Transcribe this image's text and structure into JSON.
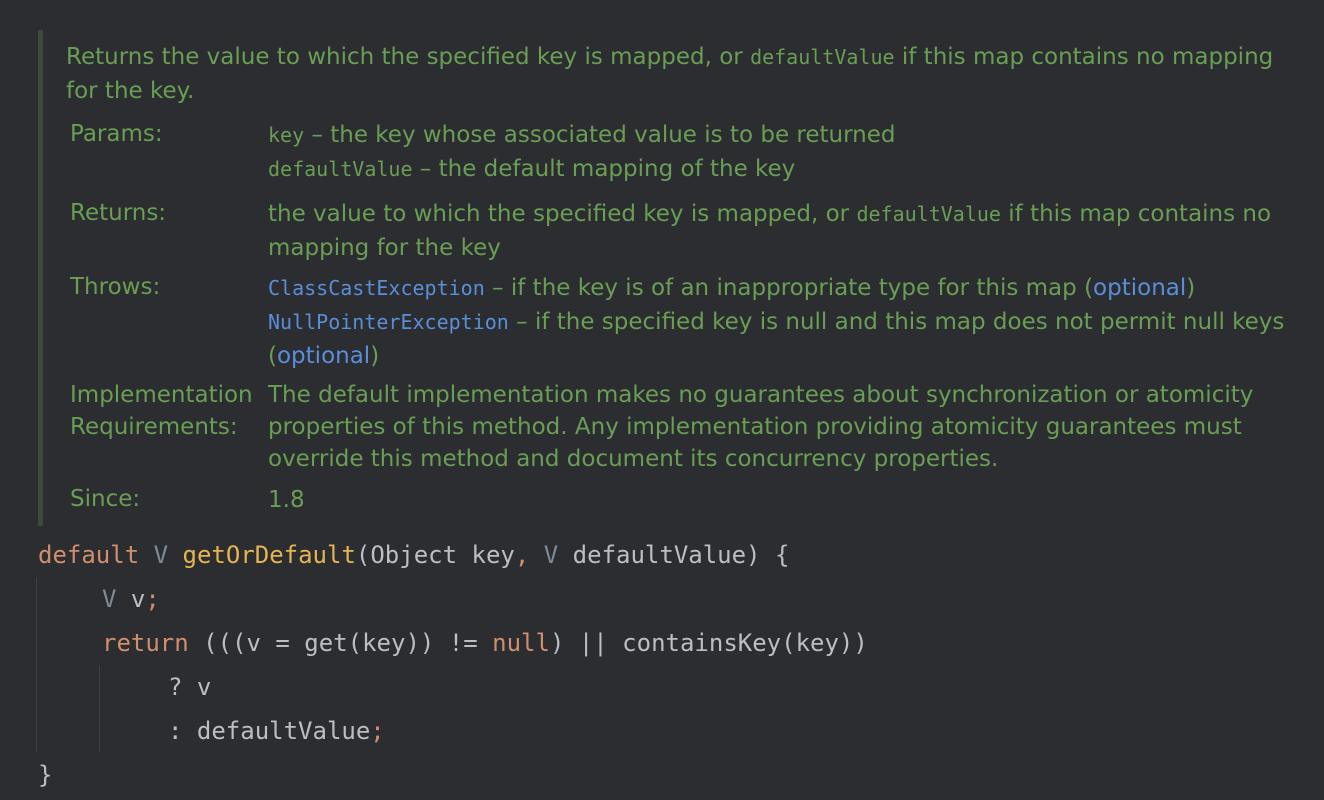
{
  "doc": {
    "summary_pre": "Returns the value to which the specified key is mapped, or ",
    "summary_code": "defaultValue",
    "summary_post": " if this map contains no mapping for the key.",
    "params_label": "Params:",
    "params": [
      {
        "name": "key",
        "text": " – the key whose associated value is to be returned"
      },
      {
        "name": "defaultValue",
        "text": " – the default mapping of the key"
      }
    ],
    "returns_label": "Returns:",
    "returns_pre": "the value to which the specified key is mapped, or ",
    "returns_code": "defaultValue",
    "returns_post": " if this map contains no mapping for the key",
    "throws_label": "Throws:",
    "throws": [
      {
        "name": "ClassCastException",
        "text": " – if the key is of an inappropriate type for this map (",
        "link": "optional",
        "close": ")"
      },
      {
        "name": "NullPointerException",
        "text": " – if the specified key is null and this map does not permit null keys (",
        "link": "optional",
        "close": ")"
      }
    ],
    "impl_label_1": "Implementation",
    "impl_label_2": "Requirements:",
    "impl_text": "The default implementation makes no guarantees about synchronization or atomicity properties of this method. Any implementation providing atomicity guarantees must override this method and document its concurrency properties.",
    "since_label": "Since:",
    "since_value": "1.8"
  },
  "code": {
    "l1": {
      "kw": "default",
      "sp1": " ",
      "type": "V",
      "sp2": " ",
      "fn": "getOrDefault",
      "p1": "(Object key",
      "comma": ",",
      "sp3": " ",
      "type2": "V",
      "p2": " defaultValue) {"
    },
    "l2": {
      "type": "V",
      "rest": " v",
      "semi": ";"
    },
    "l3": {
      "kw": "return",
      "p1": " (((v = get(key)) != ",
      "kw2": "null",
      "p2": ") || containsKey(key))"
    },
    "l4": {
      "text": "? v"
    },
    "l5": {
      "text": ": defaultValue",
      "semi": ";"
    },
    "l6": {
      "text": "}"
    }
  }
}
